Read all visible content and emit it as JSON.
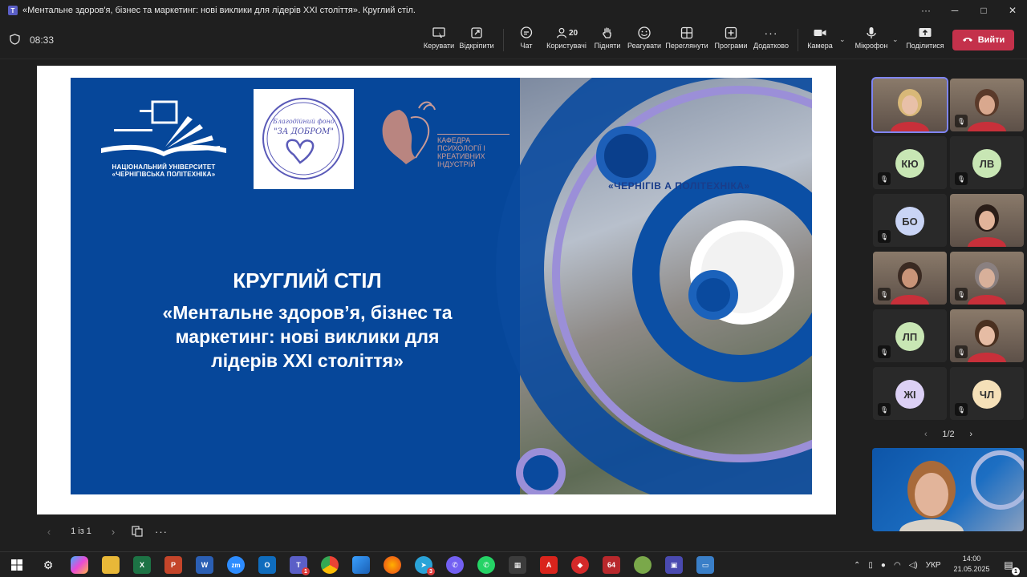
{
  "window": {
    "title": "«Ментальне здоров'я, бізнес та маркетинг: нові виклики для лідерів XXI століття». Круглий стіл.",
    "more": "···",
    "minimize": "─",
    "maximize": "□",
    "close": "✕"
  },
  "meeting": {
    "timer": "08:33",
    "toolbar": {
      "share_label": "Керувати",
      "popout_label": "Відкріпити",
      "chat_label": "Чат",
      "people_label": "Користувачі",
      "people_count": "20",
      "raise_label": "Підняти",
      "react_label": "Реагувати",
      "view_label": "Переглянути",
      "apps_label": "Програми",
      "more_label": "Додатково",
      "camera_label": "Камера",
      "mic_label": "Мікрофон",
      "share_screen_label": "Поділитися",
      "leave_label": "Вийти"
    }
  },
  "slide": {
    "uni_name_line1": "НАЦІОНАЛЬНИЙ УНІВЕРСИТЕТ",
    "uni_name_line2": "«ЧЕРНІГІВСЬКА ПОЛІТЕХНІКА»",
    "fund_name": "\"ЗА ДОБРОМ\"",
    "fund_caption": "Благодійний фонд",
    "dept_line1": "КАФЕДРА",
    "dept_line2": "ПСИХОЛОГІЇ І",
    "dept_line3": "КРЕАТИВНИХ",
    "dept_line4": "ІНДУСТРІЙ",
    "building_sign": "«ЧЕРНІГІВ   А ПОЛІТЕХНІКА»",
    "heading": "КРУГЛИЙ СТІЛ",
    "subtitle_line1": "«Ментальне здоров’я, бізнес та",
    "subtitle_line2": "маркетинг: нові виклики для",
    "subtitle_line3": "лідерів XXI століття»"
  },
  "stage_footer": {
    "page_indicator": "1 із 1"
  },
  "participants": {
    "tiles": [
      {
        "type": "video",
        "active": true
      },
      {
        "type": "video",
        "muted": true
      },
      {
        "type": "avatar",
        "initials": "КЮ",
        "color": "#c8e6b4",
        "muted": true
      },
      {
        "type": "avatar",
        "initials": "ЛВ",
        "color": "#c8e6b4",
        "muted": true
      },
      {
        "type": "avatar",
        "initials": "БО",
        "color": "#c9d4f5",
        "muted": true
      },
      {
        "type": "video",
        "muted": false
      },
      {
        "type": "video",
        "muted": true
      },
      {
        "type": "video",
        "muted": true
      },
      {
        "type": "avatar",
        "initials": "ЛП",
        "color": "#c8e6b4",
        "muted": true
      },
      {
        "type": "video",
        "muted": true
      },
      {
        "type": "avatar",
        "initials": "ЖІ",
        "color": "#dcd0f5",
        "muted": true
      },
      {
        "type": "avatar",
        "initials": "ЧЛ",
        "color": "#f5e0b8",
        "muted": true
      }
    ],
    "pager": "1/2"
  },
  "taskbar": {
    "teams_badge": "1",
    "telegram_badge": "3",
    "app_64_label": "64",
    "lang": "УКР",
    "time": "14:00",
    "date": "21.05.2025",
    "notif_badge": "1"
  }
}
